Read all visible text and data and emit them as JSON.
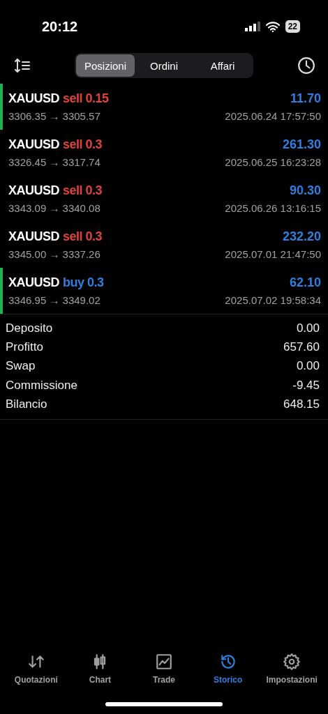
{
  "status_bar": {
    "time": "20:12",
    "battery": "22"
  },
  "tabs": [
    {
      "label": "Posizioni",
      "selected": true
    },
    {
      "label": "Ordini",
      "selected": false
    },
    {
      "label": "Affari",
      "selected": false
    }
  ],
  "deals": [
    {
      "symbol": "XAUUSD",
      "side": "sell",
      "volume": "0.15",
      "color": "#e0413a",
      "marked": true,
      "prices": "3306.35 → 3305.57",
      "profit": "11.70",
      "time": "2025.06.24 17:57:50"
    },
    {
      "symbol": "XAUUSD",
      "side": "sell",
      "volume": "0.3",
      "color": "#e0413a",
      "marked": false,
      "prices": "3326.45 → 3317.74",
      "profit": "261.30",
      "time": "2025.06.25 16:23:28"
    },
    {
      "symbol": "XAUUSD",
      "side": "sell",
      "volume": "0.3",
      "color": "#e0413a",
      "marked": false,
      "prices": "3343.09 → 3340.08",
      "profit": "90.30",
      "time": "2025.06.26 13:16:15"
    },
    {
      "symbol": "XAUUSD",
      "side": "sell",
      "volume": "0.3",
      "color": "#e0413a",
      "marked": false,
      "prices": "3345.00 → 3337.26",
      "profit": "232.20",
      "time": "2025.07.01 21:47:50"
    },
    {
      "symbol": "XAUUSD",
      "side": "buy",
      "volume": "0.3",
      "color": "#2f7fe0",
      "marked": true,
      "prices": "3346.95 → 3349.02",
      "profit": "62.10",
      "time": "2025.07.02 19:58:34"
    }
  ],
  "summary": [
    {
      "label": "Deposito",
      "value": "0.00"
    },
    {
      "label": "Profitto",
      "value": "657.60"
    },
    {
      "label": "Swap",
      "value": "0.00"
    },
    {
      "label": "Commissione",
      "value": "-9.45"
    },
    {
      "label": "Bilancio",
      "value": "648.15"
    }
  ],
  "nav": [
    {
      "label": "Quotazioni",
      "kind": "quotes",
      "selected": false
    },
    {
      "label": "Chart",
      "kind": "chart",
      "selected": false
    },
    {
      "label": "Trade",
      "kind": "trade",
      "selected": false
    },
    {
      "label": "Storico",
      "kind": "history",
      "selected": true
    },
    {
      "label": "Impostazioni",
      "kind": "settings",
      "selected": false
    }
  ]
}
